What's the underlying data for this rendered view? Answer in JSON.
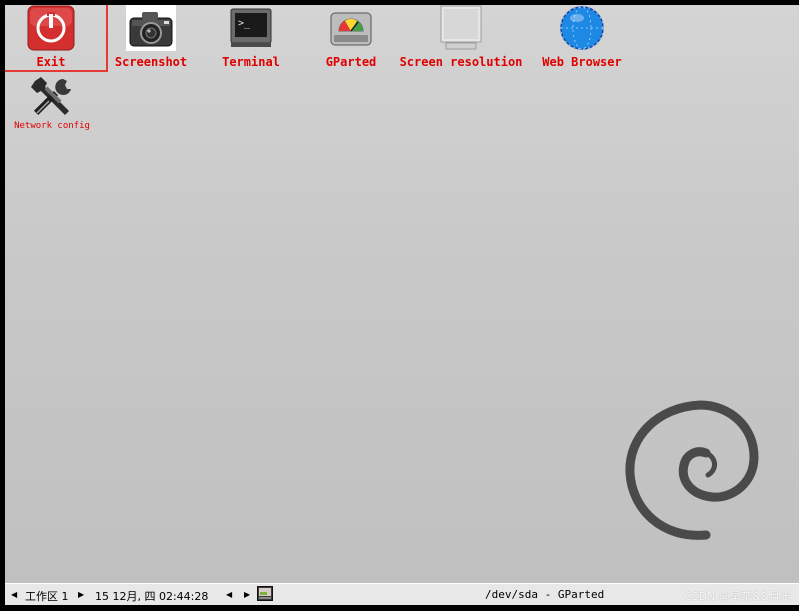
{
  "desktop": {
    "icons": [
      {
        "label": "Exit",
        "icon": "power-icon"
      },
      {
        "label": "Screenshot",
        "icon": "camera-icon"
      },
      {
        "label": "Terminal",
        "icon": "terminal-icon"
      },
      {
        "label": "GParted",
        "icon": "disk-icon"
      },
      {
        "label": "Screen resolution",
        "icon": "monitor-icon"
      },
      {
        "label": "Web Browser",
        "icon": "globe-icon"
      },
      {
        "label": "Network config",
        "icon": "tools-icon"
      }
    ],
    "logo": "debian-swirl-logo",
    "colors": {
      "label": "#e00000",
      "highlight": "#e53935",
      "exit_button": "#d32f2f",
      "browser_globe": "#1e88e5"
    }
  },
  "taskbar": {
    "workspace_label": "工作区 1",
    "datetime": "15 12月, 四 02:44:28",
    "window_title": "/dev/sda - GParted",
    "watermark": "CSDN @早茶&&月光"
  }
}
